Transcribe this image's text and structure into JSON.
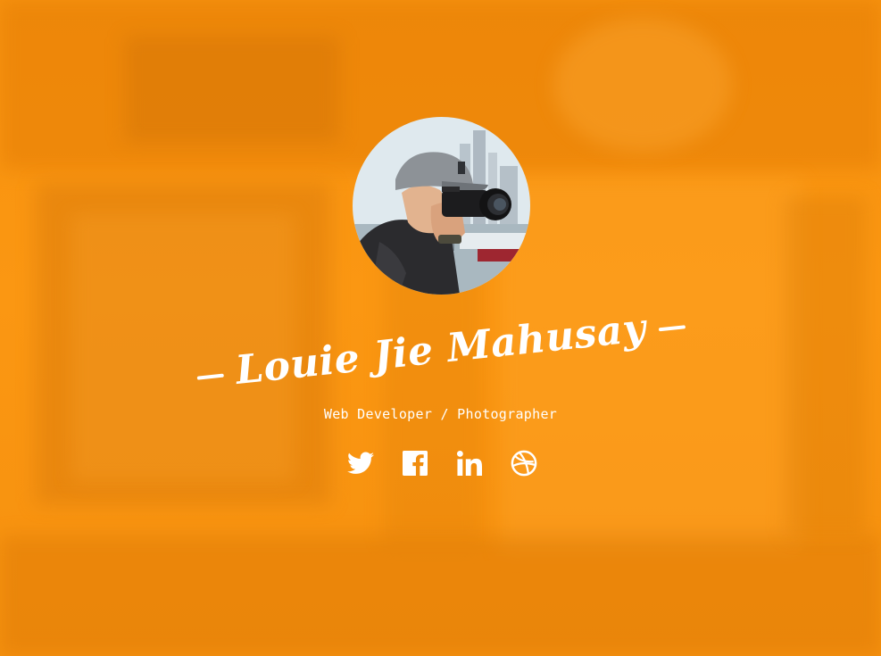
{
  "profile": {
    "name": "Louie Jie Mahusay",
    "tagline": "Web Developer / Photographer"
  },
  "social": [
    {
      "name": "twitter-icon",
      "label": "Twitter"
    },
    {
      "name": "facebook-icon",
      "label": "Facebook"
    },
    {
      "name": "linkedin-icon",
      "label": "LinkedIn"
    },
    {
      "name": "dribbble-icon",
      "label": "Dribbble"
    }
  ],
  "colors": {
    "background": "#fb9712",
    "text": "#ffffff"
  }
}
